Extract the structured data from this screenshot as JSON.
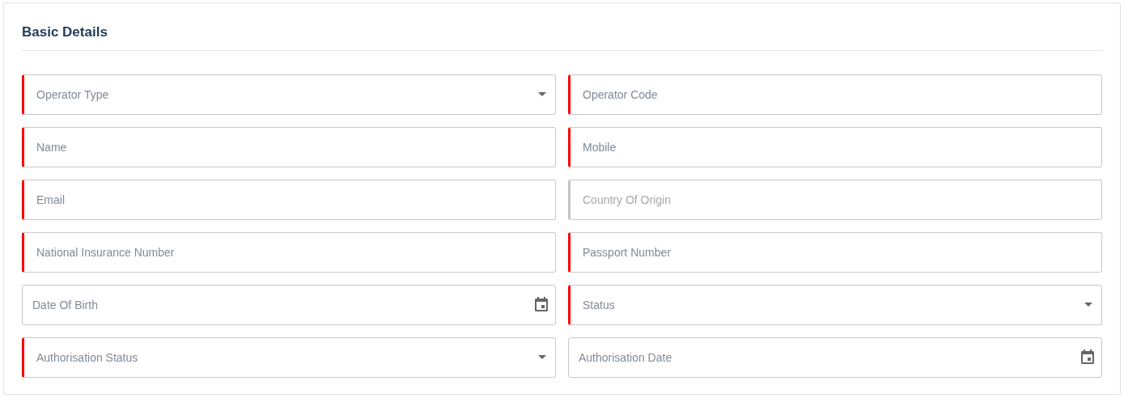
{
  "section": {
    "title": "Basic Details"
  },
  "fields": [
    {
      "placeholder": "Operator Type",
      "kind": "select",
      "required": true,
      "disabled": false
    },
    {
      "placeholder": "Operator Code",
      "kind": "text",
      "required": true,
      "disabled": false
    },
    {
      "placeholder": "Name",
      "kind": "text",
      "required": true,
      "disabled": false
    },
    {
      "placeholder": "Mobile",
      "kind": "text",
      "required": true,
      "disabled": false
    },
    {
      "placeholder": "Email",
      "kind": "text",
      "required": true,
      "disabled": false
    },
    {
      "placeholder": "Country Of Origin",
      "kind": "text",
      "required": false,
      "disabled": true
    },
    {
      "placeholder": "National Insurance Number",
      "kind": "text",
      "required": true,
      "disabled": false
    },
    {
      "placeholder": "Passport Number",
      "kind": "text",
      "required": true,
      "disabled": false
    },
    {
      "placeholder": "Date Of Birth",
      "kind": "date",
      "required": false,
      "disabled": false
    },
    {
      "placeholder": "Status",
      "kind": "select",
      "required": true,
      "disabled": false
    },
    {
      "placeholder": "Authorisation Status",
      "kind": "select",
      "required": true,
      "disabled": false
    },
    {
      "placeholder": "Authorisation Date",
      "kind": "date",
      "required": false,
      "disabled": false
    }
  ]
}
